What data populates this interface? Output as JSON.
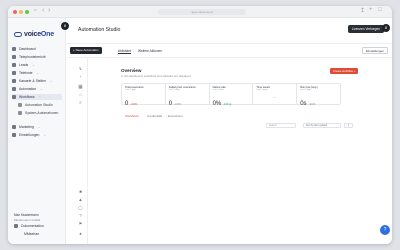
{
  "browser": {
    "url": "app.voiceone.ai"
  },
  "sidebar": {
    "logo_text_a": "voice",
    "logo_text_b": "One",
    "items": [
      {
        "label": "Dashboard",
        "icon": "dashboard-icon"
      },
      {
        "label": "Telephoniebericht",
        "icon": "phone-icon"
      },
      {
        "label": "Leads",
        "icon": "leads-icon"
      },
      {
        "label": "Telefonie",
        "icon": "telephony-icon"
      },
      {
        "label": "Kanaele & Stellen",
        "icon": "channels-icon"
      },
      {
        "label": "Automation",
        "icon": "automation-icon"
      },
      {
        "label": "Workflows",
        "icon": "workflows-icon"
      }
    ],
    "sub_items": [
      {
        "label": "Automation Studio"
      },
      {
        "label": "System-Automationen"
      }
    ],
    "items_after": [
      {
        "label": "Marketing",
        "icon": "marketing-icon"
      },
      {
        "label": "Einstellungen",
        "icon": "settings-icon"
      }
    ],
    "workspace_name": "Max Mustermann",
    "workspace_sub": "Mustermann GmbH",
    "documentation": "Dokumentation",
    "user": "MMeehan"
  },
  "topbar": {
    "title": "Automation Studio",
    "upgrade_label": "Lizenzen Verfuegen"
  },
  "subbar": {
    "new_label": "+ Neue Automation",
    "tabs": [
      "Aktivitaet",
      "Weitere Aktionen"
    ],
    "right_label": "Einstellungen"
  },
  "overview": {
    "title": "Overview",
    "subtitle": "In this dashboard, workflows and statistics are displayed",
    "create_label": "Create workflow +",
    "stats": [
      {
        "label": "Total executions",
        "period": "Last 7 days",
        "value": "0",
        "change": "-100%",
        "dir": "down"
      },
      {
        "label": "Failed prod. executions",
        "period": "Last 7 days",
        "value": "0",
        "change": "-100%",
        "dir": "neutral"
      },
      {
        "label": "Failure rate",
        "period": "Last 7 days",
        "value": "0%",
        "change": "-100 pp",
        "dir": "up"
      },
      {
        "label": "Time saved",
        "period": "Last 7 days",
        "value": "",
        "change": "",
        "dir": "neutral"
      },
      {
        "label": "Run time (avg.)",
        "period": "Last 7 days",
        "value": "0s",
        "change": "-100%",
        "dir": "neutral"
      }
    ],
    "lower_tabs": [
      "Workflows",
      "Credentials",
      "Executions"
    ],
    "search_placeholder": "Search",
    "date_filter": "Sort by last updated",
    "page_label": "1"
  },
  "badges": {
    "left": "8",
    "right": "8"
  },
  "fab_icon": "help-icon"
}
